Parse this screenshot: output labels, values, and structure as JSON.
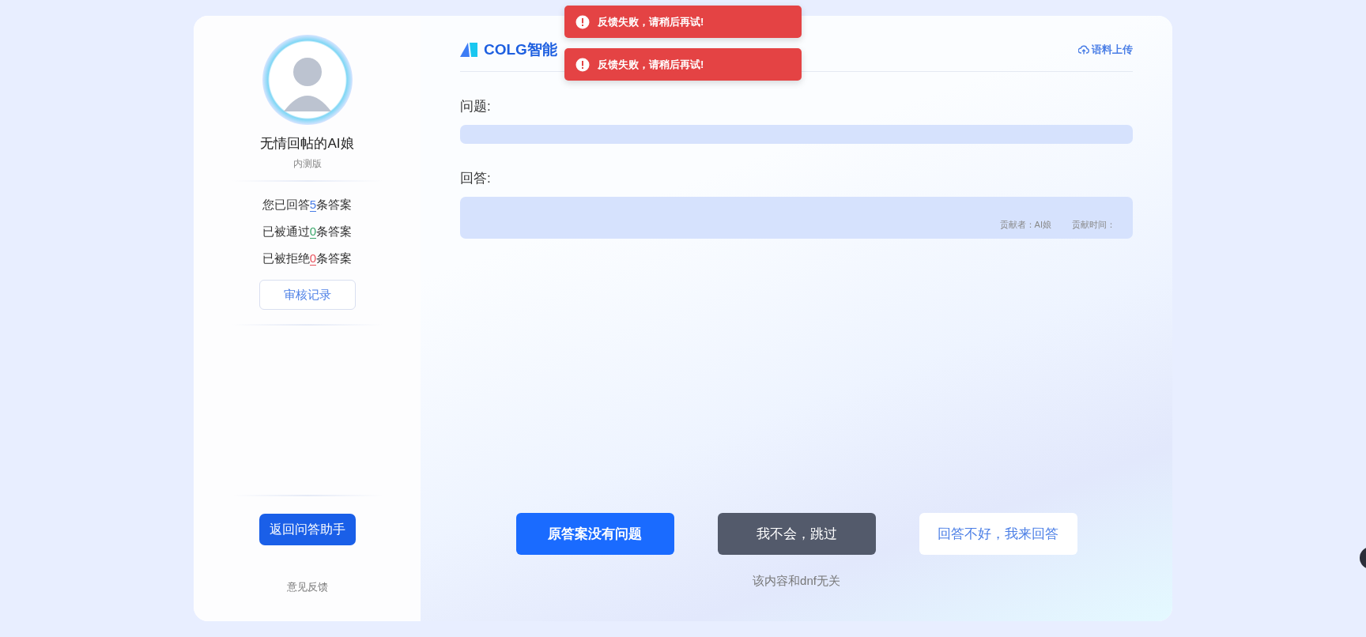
{
  "toasts": [
    {
      "kind": "error",
      "text": "反馈失败，请稍后再试!"
    },
    {
      "kind": "error",
      "text": "反馈失败，请稍后再试!"
    }
  ],
  "sidebar": {
    "name": "无情回帖的AI娘",
    "badge": "内测版",
    "stats": [
      {
        "prefix": "您已回答",
        "count": "5",
        "suffix": "条答案",
        "color": "#4a7ee6"
      },
      {
        "prefix": "已被通过",
        "count": "0",
        "suffix": "条答案",
        "color": "#3aa66a"
      },
      {
        "prefix": "已被拒绝",
        "count": "0",
        "suffix": "条答案",
        "color": "#e8505b"
      }
    ],
    "review_button": "审核记录",
    "back_button": "返回问答助手",
    "feedback_link": "意见反馈"
  },
  "header": {
    "title": "COLG智能",
    "upload_link": "语料上传"
  },
  "question": {
    "label": "问题:"
  },
  "answer": {
    "label": "回答:",
    "contributor": "贡献者：AI娘",
    "contributed_time": "贡献时间："
  },
  "actions": [
    {
      "kind": "primary",
      "label": "原答案没有问题"
    },
    {
      "kind": "dark",
      "label": "我不会，跳过"
    },
    {
      "kind": "plain",
      "label": "回答不好，我来回答"
    }
  ],
  "irrelevant_link": "该内容和dnf无关"
}
